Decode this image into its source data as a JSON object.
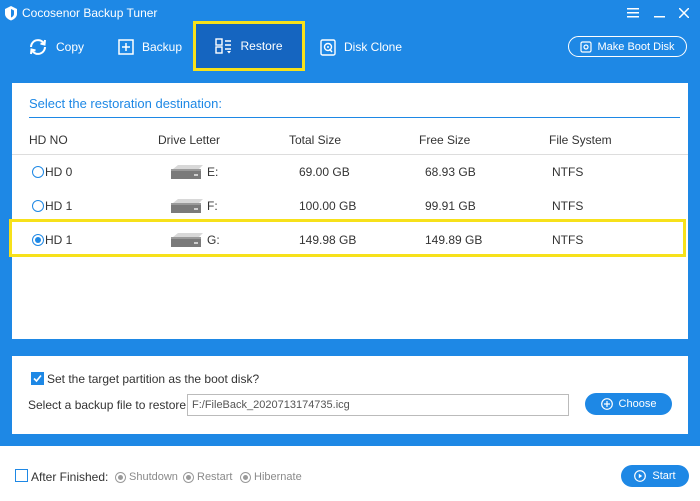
{
  "window": {
    "title": "Cocosenor Backup Tuner",
    "controls": [
      "menu-icon",
      "minimize-icon",
      "close-icon"
    ]
  },
  "toolbar": {
    "items": [
      {
        "label": "Copy",
        "icon": "copy-icon"
      },
      {
        "label": "Backup",
        "icon": "backup-icon"
      },
      {
        "label": "Restore",
        "icon": "restore-icon",
        "active": true
      },
      {
        "label": "Disk Clone",
        "icon": "disk-clone-icon"
      }
    ],
    "boot_disk_label": "Make Boot Disk"
  },
  "main": {
    "heading": "Select the restoration destination:",
    "columns": [
      "HD NO",
      "Drive Letter",
      "Total Size",
      "Free Size",
      "File System"
    ],
    "rows": [
      {
        "hd": "HD 0",
        "letter": "E:",
        "total": "69.00 GB",
        "free": "68.93 GB",
        "fs": "NTFS",
        "selected": false
      },
      {
        "hd": "HD 1",
        "letter": "F:",
        "total": "100.00 GB",
        "free": "99.91 GB",
        "fs": "NTFS",
        "selected": false
      },
      {
        "hd": "HD 1",
        "letter": "G:",
        "total": "149.98 GB",
        "free": "149.89 GB",
        "fs": "NTFS",
        "selected": true
      }
    ]
  },
  "options": {
    "boot_label": "Set the target partition as the boot disk?",
    "boot_checked": true,
    "file_label": "Select a backup file to restore:",
    "file_value": "F:/FileBack_2020713174735.icg",
    "choose_label": "Choose"
  },
  "footer": {
    "after_label": "After Finished:",
    "after_checked": false,
    "choices": [
      "Shutdown",
      "Restart",
      "Hibernate"
    ],
    "start_label": "Start"
  },
  "colors": {
    "accent": "#1e88e5",
    "active_tab": "#1565c0",
    "highlight": "#f7e11a"
  }
}
